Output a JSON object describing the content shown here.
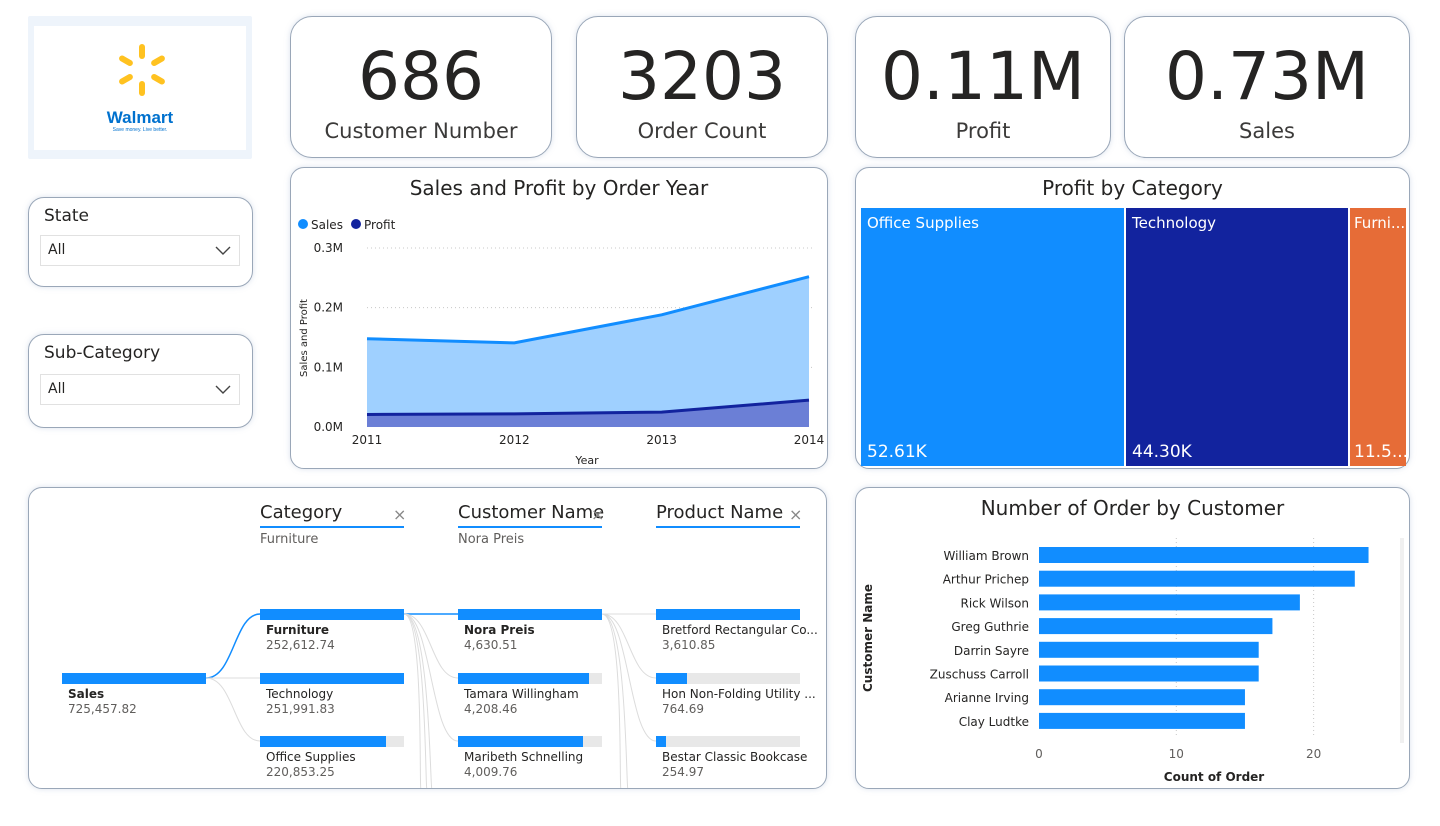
{
  "logo": {
    "brand": "Walmart",
    "tagline": "Save money. Live better."
  },
  "kpis": [
    {
      "value": "686",
      "label": "Customer Number"
    },
    {
      "value": "3203",
      "label": "Order Count"
    },
    {
      "value": "0.11M",
      "label": "Profit"
    },
    {
      "value": "0.73M",
      "label": "Sales"
    }
  ],
  "slicers": [
    {
      "title": "State",
      "value": "All",
      "icon": "chevron-down-icon"
    },
    {
      "title": "Sub-Category",
      "value": "All",
      "icon": "chevron-down-icon"
    }
  ],
  "area_chart": {
    "title": "Sales and Profit by Order Year",
    "legend": [
      "Sales",
      "Profit"
    ],
    "ylabel": "Sales and Profit",
    "xlabel": "Year",
    "yticks": [
      "0.3M",
      "0.2M",
      "0.1M",
      "0.0M"
    ],
    "xticks": [
      "2011",
      "2012",
      "2013",
      "2014"
    ]
  },
  "treemap": {
    "title": "Profit by Category",
    "tiles": [
      {
        "label": "Office Supplies",
        "value": "52.61K"
      },
      {
        "label": "Technology",
        "value": "44.30K"
      },
      {
        "label": "Furni...",
        "value": "11.5..."
      }
    ]
  },
  "decomp_tree": {
    "levels": [
      {
        "header": "Category",
        "selected": "Furniture"
      },
      {
        "header": "Customer Name",
        "selected": "Nora Preis"
      },
      {
        "header": "Product Name",
        "selected": ""
      }
    ],
    "root": {
      "name": "Sales",
      "value": "725,457.82"
    },
    "category_nodes": [
      {
        "name": "Furniture",
        "value": "252,612.74"
      },
      {
        "name": "Technology",
        "value": "251,991.83"
      },
      {
        "name": "Office Supplies",
        "value": "220,853.25"
      }
    ],
    "customer_nodes": [
      {
        "name": "Nora Preis",
        "value": "4,630.51"
      },
      {
        "name": "Tamara Willingham",
        "value": "4,208.46"
      },
      {
        "name": "Maribeth Schnelling",
        "value": "4,009.76"
      }
    ],
    "product_nodes": [
      {
        "name": "Bretford Rectangular Co...",
        "value": "3,610.85"
      },
      {
        "name": "Hon Non-Folding Utility ...",
        "value": "764.69"
      },
      {
        "name": "Bestar Classic Bookcase",
        "value": "254.97"
      }
    ]
  },
  "bar_chart": {
    "title": "Number of Order by Customer",
    "ylabel": "Customer Name",
    "xlabel": "Count of Order",
    "xticks": [
      "0",
      "10",
      "20"
    ]
  },
  "colors": {
    "sales": "#118dff",
    "sales_area": "#9fd0ff",
    "profit": "#12239e",
    "profit_area": "#6b7fd6",
    "orange": "#e66c37"
  },
  "chart_data": [
    {
      "type": "area",
      "title": "Sales and Profit by Order Year",
      "x": [
        2011,
        2012,
        2013,
        2014
      ],
      "series": [
        {
          "name": "Sales",
          "values": [
            148000,
            141000,
            188000,
            252000
          ]
        },
        {
          "name": "Profit",
          "values": [
            21000,
            22000,
            25000,
            45000
          ]
        }
      ],
      "xlabel": "Year",
      "ylabel": "Sales and Profit",
      "ylim": [
        0,
        300000
      ],
      "legend": "top-left",
      "grid": true
    },
    {
      "type": "treemap",
      "title": "Profit by Category",
      "categories": [
        "Office Supplies",
        "Technology",
        "Furniture"
      ],
      "values": [
        52610,
        44300,
        11500
      ]
    },
    {
      "type": "bar",
      "title": "Number of Order by Customer",
      "categories": [
        "William Brown",
        "Arthur Prichep",
        "Rick Wilson",
        "Greg Guthrie",
        "Darrin Sayre",
        "Zuschuss Carroll",
        "Arianne Irving",
        "Clay Ludtke"
      ],
      "values": [
        24,
        23,
        19,
        17,
        16,
        16,
        15,
        15
      ],
      "xlabel": "Count of Order",
      "ylabel": "Customer Name",
      "xlim": [
        0,
        26
      ]
    }
  ],
  "decomp_fractions": {
    "category": [
      1.0,
      0.9975,
      0.874
    ],
    "customer": [
      1.0,
      0.909,
      0.866
    ],
    "product": [
      1.0,
      0.212,
      0.071
    ]
  }
}
